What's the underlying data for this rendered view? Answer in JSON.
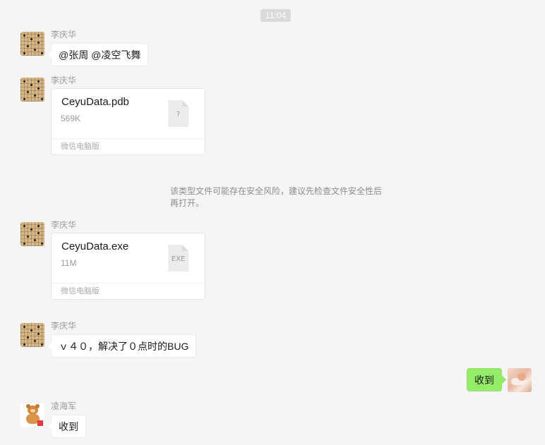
{
  "timestamp": "11:04",
  "messages": [
    {
      "sender": "李庆华",
      "text": "@张周 @凌空飞舞"
    },
    {
      "sender": "李庆华",
      "file": {
        "name": "CeyuData.pdb",
        "size": "569K",
        "icon_label": "?",
        "source": "微信电脑版",
        "icon": "unknown-file-icon"
      }
    },
    {
      "system": "该类型文件可能存在安全风险，建议先检查文件安全性后再打开。"
    },
    {
      "sender": "李庆华",
      "file": {
        "name": "CeyuData.exe",
        "size": "11M",
        "icon_label": "EXE",
        "source": "微信电脑版",
        "icon": "exe-file-icon"
      }
    },
    {
      "sender": "李庆华",
      "text": "ｖ４０，解决了０点时的BUG"
    },
    {
      "sender": "",
      "text": "收到",
      "mine": true
    },
    {
      "sender": "凌海军",
      "text": "收到"
    }
  ],
  "colors": {
    "background": "#f5f5f5",
    "own_bubble": "#95ec69",
    "other_bubble": "#ffffff",
    "sender_text": "#9a9a9a"
  }
}
